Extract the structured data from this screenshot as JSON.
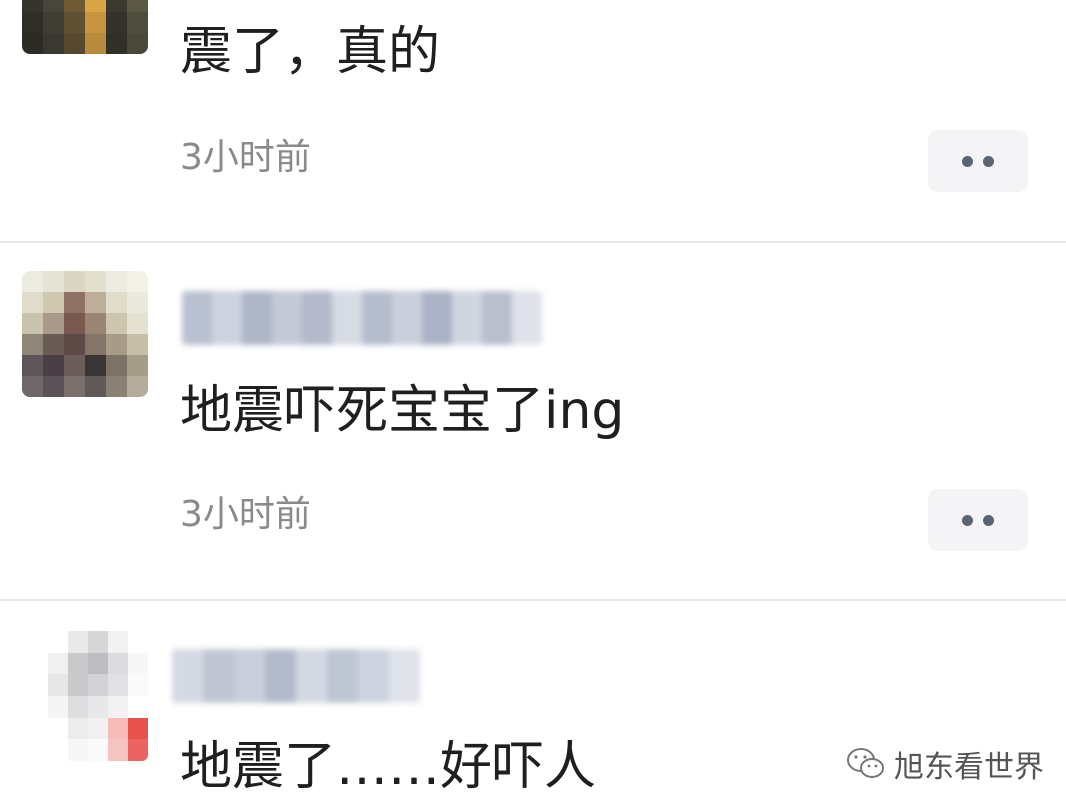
{
  "posts": [
    {
      "content": "震了，真的",
      "time": "3小时前"
    },
    {
      "content": "地震吓死宝宝了ing",
      "time": "3小时前"
    },
    {
      "content": "地震了……好吓人"
    }
  ],
  "watermark": {
    "text": "旭东看世界",
    "icon": "wechat-icon"
  },
  "colors": {
    "text": "#1f1f1f",
    "timestamp": "#8a8a8e",
    "more_button_bg": "#f4f4f6",
    "dot": "#5b6472",
    "divider": "#e9e9eb"
  }
}
